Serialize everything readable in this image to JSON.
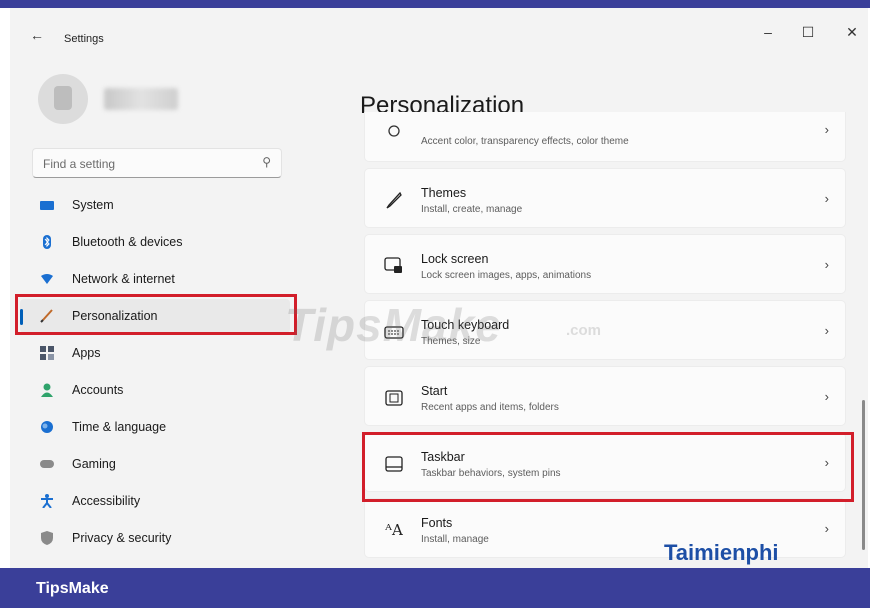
{
  "window": {
    "title": "Settings",
    "back_icon": "←",
    "minimize_icon": "–",
    "maximize_icon": "☐",
    "close_icon": "✕"
  },
  "search": {
    "placeholder": "Find a setting",
    "icon": "⚲"
  },
  "nav": {
    "items": [
      {
        "label": "System",
        "icon": "system-icon",
        "color": "#1a6fd1"
      },
      {
        "label": "Bluetooth & devices",
        "icon": "bluetooth-icon",
        "color": "#1a6fd1"
      },
      {
        "label": "Network & internet",
        "icon": "network-icon",
        "color": "#1a6fd1"
      },
      {
        "label": "Personalization",
        "icon": "brush-icon",
        "color": "#c06a2a"
      },
      {
        "label": "Apps",
        "icon": "apps-icon",
        "color": "#4a5568"
      },
      {
        "label": "Accounts",
        "icon": "accounts-icon",
        "color": "#2fa36b"
      },
      {
        "label": "Time & language",
        "icon": "globe-icon",
        "color": "#1a6fd1"
      },
      {
        "label": "Gaming",
        "icon": "gamepad-icon",
        "color": "#6b6b6b"
      },
      {
        "label": "Accessibility",
        "icon": "accessibility-icon",
        "color": "#1a6fd1"
      },
      {
        "label": "Privacy & security",
        "icon": "shield-icon",
        "color": "#6b6b6b"
      }
    ],
    "active": "Personalization"
  },
  "main": {
    "title": "Personalization",
    "cards": [
      {
        "title": "",
        "desc": "Accent color, transparency effects, color theme",
        "icon": "colors-icon"
      },
      {
        "title": "Themes",
        "desc": "Install, create, manage",
        "icon": "pen-icon"
      },
      {
        "title": "Lock screen",
        "desc": "Lock screen images, apps, animations",
        "icon": "lock-screen-icon"
      },
      {
        "title": "Touch keyboard",
        "desc": "Themes, size",
        "icon": "keyboard-icon"
      },
      {
        "title": "Start",
        "desc": "Recent apps and items, folders",
        "icon": "start-icon"
      },
      {
        "title": "Taskbar",
        "desc": "Taskbar behaviors, system pins",
        "icon": "taskbar-icon"
      },
      {
        "title": "Fonts",
        "desc": "Install, manage",
        "icon": "fonts-icon"
      }
    ]
  },
  "watermarks": {
    "tipsmake": "TipsMake",
    "com": ".com",
    "taimienphi": "Taimienphi"
  },
  "footer": {
    "brand": "TipsMake"
  },
  "colors": {
    "accent": "#005fb8",
    "highlight": "#d21e2a",
    "frame": "#3a3f99"
  }
}
